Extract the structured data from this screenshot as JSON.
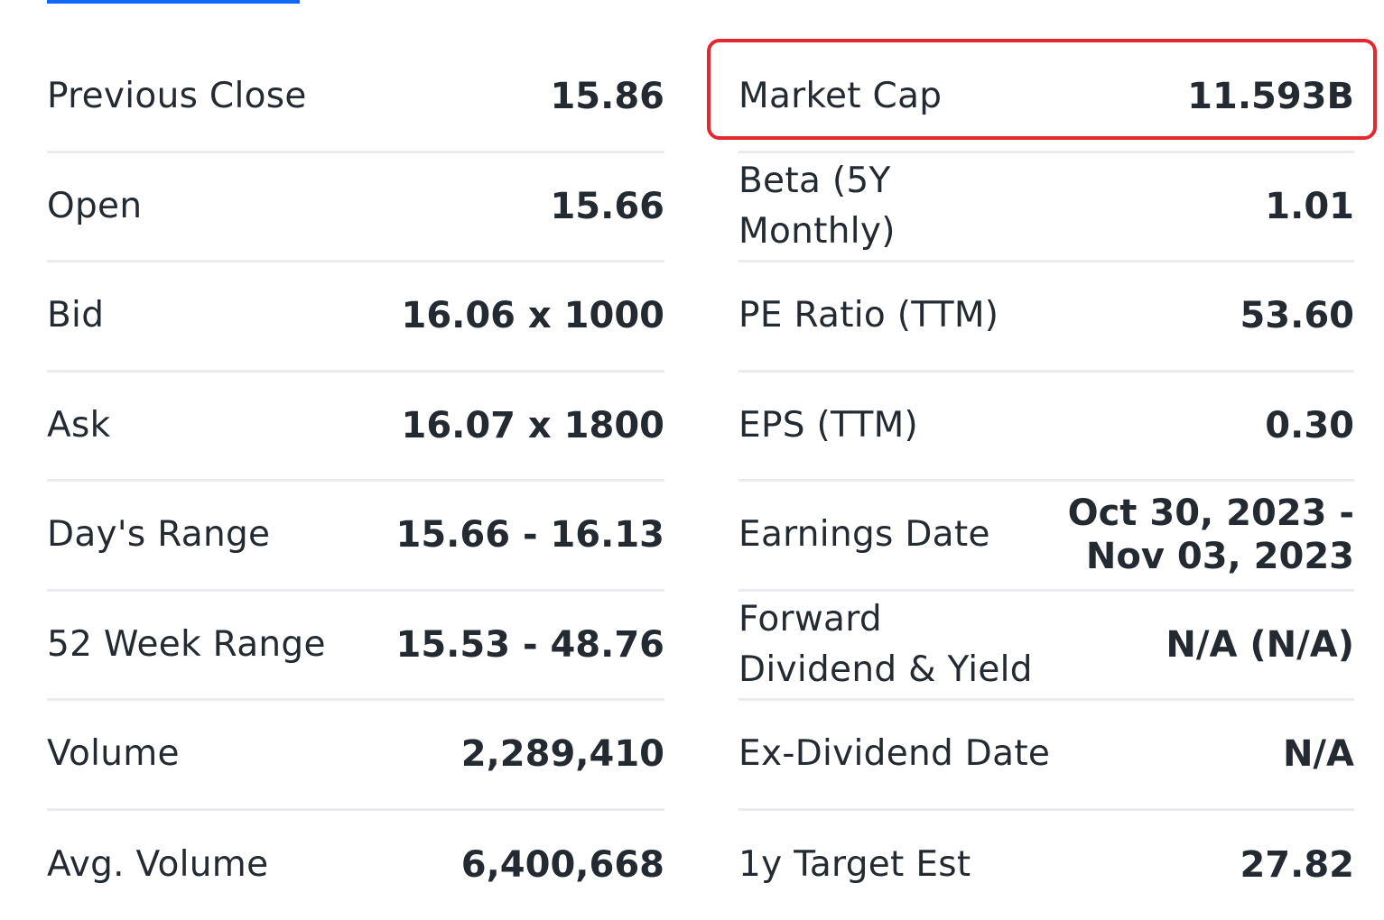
{
  "summary": {
    "left": [
      {
        "label": "Previous Close",
        "value": "15.86"
      },
      {
        "label": "Open",
        "value": "15.66"
      },
      {
        "label": "Bid",
        "value": "16.06 x 1000"
      },
      {
        "label": "Ask",
        "value": "16.07 x 1800"
      },
      {
        "label": "Day's Range",
        "value": "15.66 - 16.13"
      },
      {
        "label": "52 Week Range",
        "value": "15.53 - 48.76"
      },
      {
        "label": "Volume",
        "value": "2,289,410"
      },
      {
        "label": "Avg. Volume",
        "value": "6,400,668"
      }
    ],
    "right": [
      {
        "label": "Market Cap",
        "value": "11.593B"
      },
      {
        "label": "Beta (5Y\nMonthly)",
        "value": "1.01"
      },
      {
        "label": "PE Ratio (TTM)",
        "value": "53.60"
      },
      {
        "label": "EPS (TTM)",
        "value": "0.30"
      },
      {
        "label": "Earnings Date",
        "value": "Oct 30, 2023 -\nNov 03, 2023"
      },
      {
        "label": "Forward\nDividend & Yield",
        "value": "N/A (N/A)"
      },
      {
        "label": "Ex-Dividend Date",
        "value": "N/A"
      },
      {
        "label": "1y Target Est",
        "value": "27.82"
      }
    ]
  },
  "highlight": {
    "color": "#e3282f"
  },
  "colors": {
    "text": "#232a31",
    "divider": "#e9ebef",
    "tab_accent": "#0f69ff"
  }
}
